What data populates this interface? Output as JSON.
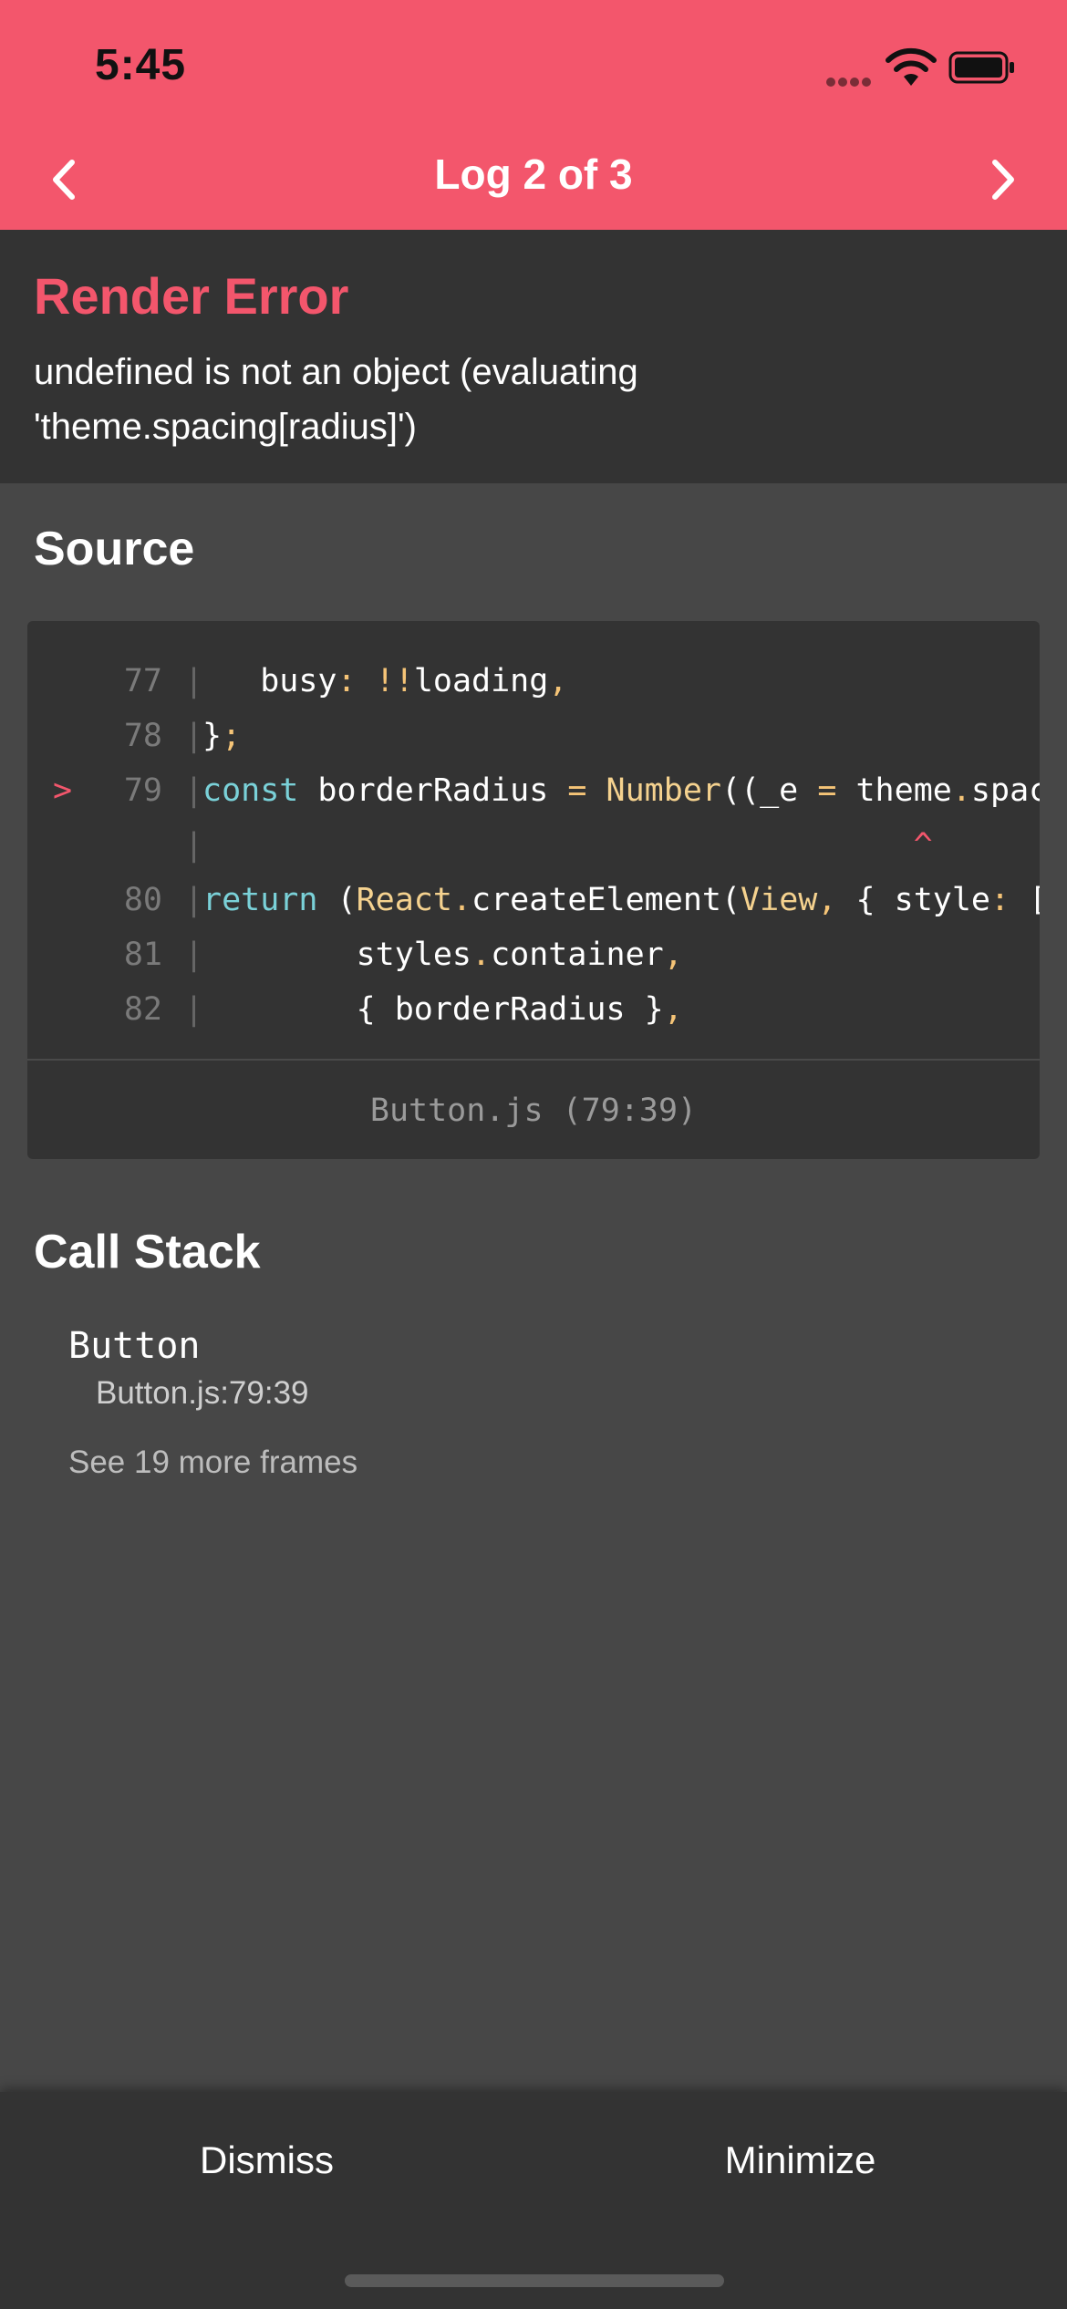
{
  "status_bar": {
    "time": "5:45",
    "icons": [
      "cellular-signal-icon",
      "wifi-icon",
      "battery-icon"
    ]
  },
  "nav": {
    "title": "Log 2 of 3",
    "prev_icon": "chevron-left-icon",
    "next_icon": "chevron-right-icon"
  },
  "error": {
    "title": "Render Error",
    "message": "undefined is not an object (evaluating 'theme.spacing[radius]')"
  },
  "source": {
    "title": "Source",
    "lines": [
      {
        "marker": "",
        "number": "77",
        "code": "   busy: !!loading,"
      },
      {
        "marker": "",
        "number": "78",
        "code": "};"
      },
      {
        "marker": ">",
        "number": "79",
        "code": "const borderRadius = Number((_e = theme.spacing[radius]"
      },
      {
        "marker": "",
        "number": "",
        "code": "                                     ^"
      },
      {
        "marker": "",
        "number": "80",
        "code": "return (React.createElement(View, { style: ["
      },
      {
        "marker": "",
        "number": "81",
        "code": "        styles.container,"
      },
      {
        "marker": "",
        "number": "82",
        "code": "        { borderRadius },"
      }
    ],
    "file_location": "Button.js (79:39)"
  },
  "call_stack": {
    "title": "Call Stack",
    "frames": [
      {
        "name": "Button",
        "location": "Button.js:79:39"
      }
    ],
    "more_frames": "See 19 more frames"
  },
  "footer": {
    "dismiss_label": "Dismiss",
    "minimize_label": "Minimize"
  },
  "colors": {
    "accent": "#f3566c",
    "background": "#474747",
    "panel": "#333333",
    "keyword": "#7ad1d8",
    "operator": "#f5c477"
  }
}
